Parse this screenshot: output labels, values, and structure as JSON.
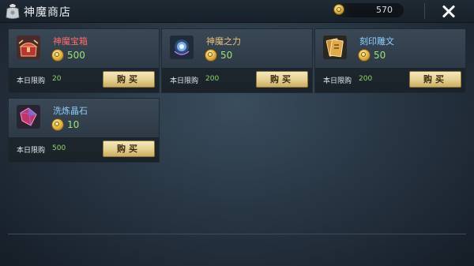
{
  "header": {
    "title": "神魔商店",
    "currency_amount": "570"
  },
  "items": [
    {
      "name": "神魔宝箱",
      "price": "500",
      "limit_label": "本日限购",
      "limit_value": "20",
      "buy_label": "购买",
      "name_color": "#ff6b6b"
    },
    {
      "name": "神魔之力",
      "price": "50",
      "limit_label": "本日限购",
      "limit_value": "200",
      "buy_label": "购买",
      "name_color": "#e9c27a"
    },
    {
      "name": "刻印雕文",
      "price": "50",
      "limit_label": "本日限购",
      "limit_value": "200",
      "buy_label": "购买",
      "name_color": "#8fd0ff"
    },
    {
      "name": "洗炼晶石",
      "price": "10",
      "limit_label": "本日限购",
      "limit_value": "500",
      "buy_label": "购买",
      "name_color": "#8fd0ff"
    }
  ],
  "colors": {
    "price_green": "#9be27a",
    "limit_green": "#8fd46b",
    "buy_button": "#e4cf8f"
  },
  "icons": {
    "header": "bag-icon",
    "currency": "gold-coin-icon",
    "close": "close-icon",
    "items": [
      "treasure-chest-icon",
      "magic-orb-icon",
      "rune-card-icon",
      "crystal-icon"
    ]
  }
}
